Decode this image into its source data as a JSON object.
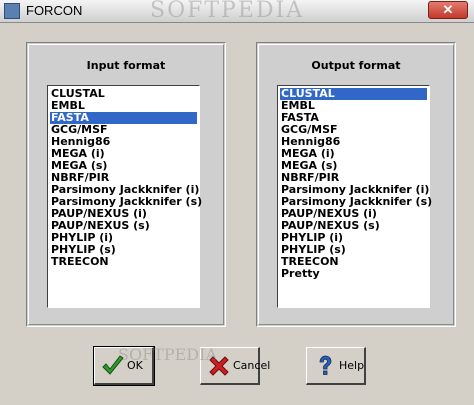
{
  "window": {
    "title": "FORCON"
  },
  "watermark": "SOFTPEDIA",
  "input": {
    "label": "Input format",
    "items": [
      "CLUSTAL",
      "EMBL",
      "FASTA",
      "GCG/MSF",
      "Hennig86",
      "MEGA (i)",
      "MEGA (s)",
      "NBRF/PIR",
      "Parsimony Jackknifer (i)",
      "Parsimony Jackknifer (s)",
      "PAUP/NEXUS (i)",
      "PAUP/NEXUS (s)",
      "PHYLIP (i)",
      "PHYLIP (s)",
      "TREECON"
    ],
    "selected": "FASTA"
  },
  "output": {
    "label": "Output format",
    "items": [
      "CLUSTAL",
      "EMBL",
      "FASTA",
      "GCG/MSF",
      "Hennig86",
      "MEGA (i)",
      "MEGA (s)",
      "NBRF/PIR",
      "Parsimony Jackknifer (i)",
      "Parsimony Jackknifer (s)",
      "PAUP/NEXUS (i)",
      "PAUP/NEXUS (s)",
      "PHYLIP (i)",
      "PHYLIP (s)",
      "TREECON",
      "Pretty"
    ],
    "selected": "CLUSTAL"
  },
  "buttons": {
    "ok": "OK",
    "cancel": "Cancel",
    "help": "Help"
  },
  "icons": {
    "ok": "checkmark-icon",
    "cancel": "x-icon",
    "help": "question-mark-icon",
    "close": "close-icon"
  },
  "colors": {
    "selection": "#3168c8",
    "ok_icon": "#2e9a2e",
    "cancel_icon": "#cc1f1f",
    "help_icon": "#2a5fb5"
  }
}
